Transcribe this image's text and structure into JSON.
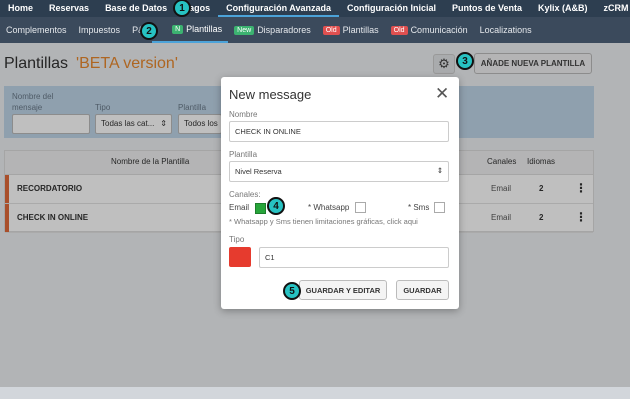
{
  "top_nav": [
    "Home",
    "Reservas",
    "Base de Datos",
    "Pagos",
    "Configuración Avanzada",
    "Configuración Inicial",
    "Puntos de Venta",
    "Kylix (A&B)",
    "zCRM"
  ],
  "sub_nav": {
    "complementos": "Complementos",
    "impuestos": "Impuestos",
    "pl": "P&l",
    "plantillas": "Plantillas",
    "disparadores": "Disparadores",
    "old_plantillas": "Plantillas",
    "comunicacion": "Comunicación",
    "localizations": "Localizations",
    "badge_new": "New",
    "badge_old": "Old"
  },
  "steps": [
    "1",
    "2",
    "3",
    "4",
    "5"
  ],
  "page": {
    "title": "Plantillas",
    "beta": "'BETA version'",
    "add_button": "AÑADE NUEVA PLANTILLA"
  },
  "filters": {
    "nombre_label": "Nombre del mensaje",
    "tipo_label": "Tipo",
    "tipo_value": "Todas las cat...",
    "plantilla_label": "Plantilla",
    "plantilla_value": "Todos los"
  },
  "table": {
    "headers": {
      "nombre": "Nombre de la Plantilla",
      "canales": "Canales",
      "idiomas": "Idiomas"
    },
    "rows": [
      {
        "name": "RECORDATORIO",
        "channel": "Email",
        "languages": "2"
      },
      {
        "name": "CHECK IN ONLINE",
        "channel": "Email",
        "languages": "2"
      }
    ]
  },
  "modal": {
    "title": "New message",
    "nombre_label": "Nombre",
    "nombre_value": "CHECK IN ONLINE",
    "plantilla_label": "Plantilla",
    "plantilla_value": "Nivel Reserva",
    "canales_label": "Canales:",
    "email_label": "Email",
    "whatsapp_label": "* Whatsapp",
    "sms_label": "* Sms",
    "note": "* Whatsapp y Sms tienen limitaciones gráficas, click aqui",
    "tipo_label": "Tipo",
    "tipo_value": "C1",
    "tipo_color": "#e63b2e",
    "save_edit_button": "GUARDAR Y EDITAR",
    "save_button": "GUARDAR"
  },
  "colors": {
    "top_nav_bg": "#2d3e50",
    "accent_step": "#27c2c2",
    "beta_orange": "#e8892e",
    "email_checked": "#27a53a"
  }
}
